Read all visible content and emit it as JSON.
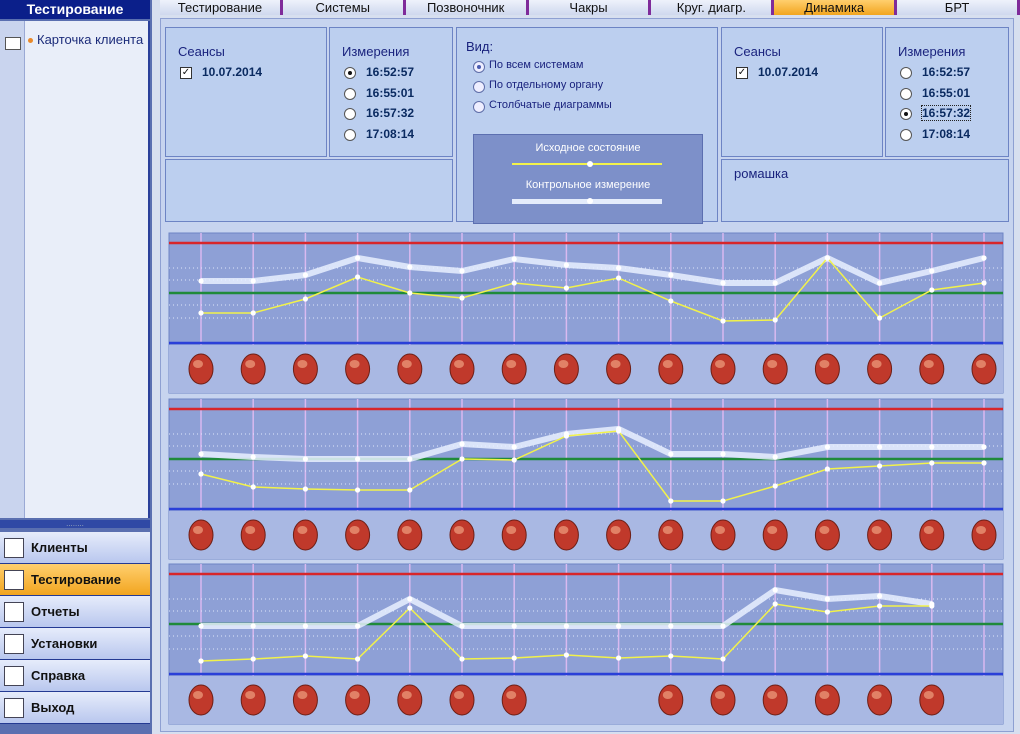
{
  "sidebar": {
    "title": "Тестирование",
    "card_item": "Карточка клиента",
    "grip": "........",
    "nav": [
      {
        "label": "Клиенты",
        "icon": "clients-icon",
        "active": false
      },
      {
        "label": "Тестирование",
        "icon": "testing-icon",
        "active": true
      },
      {
        "label": "Отчеты",
        "icon": "printer-icon",
        "active": false
      },
      {
        "label": "Установки",
        "icon": "tools-icon",
        "active": false
      },
      {
        "label": "Справка",
        "icon": "help-icon",
        "active": false
      },
      {
        "label": "Выход",
        "icon": "exit-icon",
        "active": false
      }
    ]
  },
  "tabs": [
    {
      "label": "Тестирование",
      "active": false
    },
    {
      "label": "Системы",
      "active": false
    },
    {
      "label": "Позвоночник",
      "active": false
    },
    {
      "label": "Чакры",
      "active": false
    },
    {
      "label": "Круг. диагр.",
      "active": false
    },
    {
      "label": "Динамика",
      "active": true
    },
    {
      "label": "БРТ",
      "active": false
    }
  ],
  "left": {
    "sessions_title": "Сеансы",
    "session_date": "10.07.2014",
    "session_checked": true,
    "measurements_title": "Измерения",
    "times": [
      "16:52:57",
      "16:55:01",
      "16:57:32",
      "17:08:14"
    ],
    "selected_index": 0,
    "note": ""
  },
  "right": {
    "sessions_title": "Сеансы",
    "session_date": "10.07.2014",
    "session_checked": true,
    "measurements_title": "Измерения",
    "times": [
      "16:52:57",
      "16:55:01",
      "16:57:32",
      "17:08:14"
    ],
    "selected_index": 2,
    "note": "ромашка"
  },
  "view": {
    "title": "Вид:",
    "options": [
      "По всем системам",
      "По отдельному органу",
      "Столбчатые диаграммы"
    ],
    "selected_index": 0,
    "legend_initial": "Исходное состояние",
    "legend_control": "Контрольное измерение"
  },
  "colors": {
    "accent": "#f2a51f",
    "sidebar_dark": "#0b1f8a",
    "line_initial": "#f2f24a",
    "line_control": "#e9f0ff",
    "limit_top": "#d8262a",
    "limit_mid": "#1f8a3a",
    "limit_bottom": "#2a3fd8"
  },
  "chart_data": [
    {
      "type": "line",
      "ylim": [
        0,
        100
      ],
      "series": [
        {
          "values": [
            30,
            30,
            44,
            66,
            50,
            45,
            60,
            55,
            65,
            42,
            22,
            23,
            85,
            25,
            53,
            60
          ]
        },
        {
          "values": [
            62,
            62,
            68,
            85,
            76,
            72,
            84,
            78,
            75,
            68,
            60,
            60,
            85,
            60,
            72,
            85
          ]
        }
      ],
      "markers": [
        "organ-icon",
        "organ-icon",
        "organ-icon",
        "organ-icon",
        "organ-icon",
        "organ-icon",
        "organ-icon",
        "organ-icon",
        "organ-icon",
        "organ-icon",
        "organ-icon",
        "organ-icon",
        "organ-icon",
        "organ-icon",
        "organ-icon",
        "organ-icon"
      ]
    },
    {
      "type": "line",
      "ylim": [
        0,
        100
      ],
      "series": [
        {
          "values": [
            35,
            22,
            20,
            19,
            19,
            50,
            49,
            73,
            78,
            8,
            8,
            23,
            40,
            43,
            46,
            46
          ]
        },
        {
          "values": [
            55,
            52,
            50,
            50,
            50,
            65,
            62,
            75,
            80,
            55,
            55,
            52,
            62,
            62,
            62,
            62
          ]
        }
      ],
      "markers": [
        "organ-icon",
        "organ-icon",
        "organ-icon",
        "organ-icon",
        "organ-icon",
        "organ-icon",
        "organ-icon",
        "organ-icon",
        "organ-icon",
        "organ-icon",
        "organ-icon",
        "organ-icon",
        "organ-icon",
        "organ-icon",
        "organ-icon",
        "organ-icon"
      ]
    },
    {
      "type": "line",
      "ylim": [
        0,
        100
      ],
      "series": [
        {
          "values": [
            13,
            15,
            18,
            15,
            66,
            15,
            16,
            19,
            16,
            18,
            15,
            70,
            62,
            68,
            68
          ]
        },
        {
          "values": [
            48,
            48,
            48,
            48,
            75,
            48,
            48,
            48,
            48,
            48,
            48,
            84,
            75,
            78,
            70
          ]
        }
      ],
      "markers": [
        "organ-icon",
        "organ-icon",
        "organ-icon",
        "organ-icon",
        "organ-icon",
        "organ-icon",
        "organ-icon",
        "",
        "",
        "organ-icon",
        "organ-icon",
        "organ-icon",
        "organ-icon",
        "organ-icon",
        "organ-icon"
      ]
    }
  ]
}
